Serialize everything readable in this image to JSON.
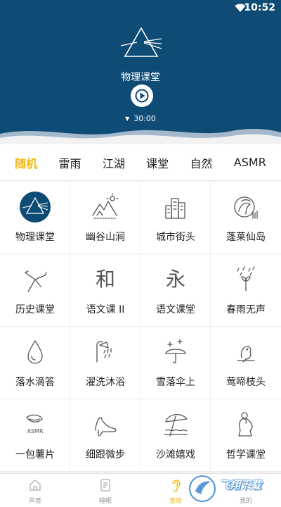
{
  "status_bar": {
    "time": "10:52",
    "wifi_icon": "wifi-icon"
  },
  "now_playing": {
    "title": "物理课堂",
    "timer": "30:00",
    "icon": "prism-icon"
  },
  "tabs": [
    {
      "label": "随机",
      "active": true
    },
    {
      "label": "雷雨",
      "active": false
    },
    {
      "label": "江湖",
      "active": false
    },
    {
      "label": "课堂",
      "active": false
    },
    {
      "label": "自然",
      "active": false
    },
    {
      "label": "ASMR",
      "active": false
    }
  ],
  "sounds": [
    {
      "label": "物理课堂",
      "icon": "prism-icon",
      "selected": true
    },
    {
      "label": "幽谷山涧",
      "icon": "valley-icon"
    },
    {
      "label": "城市街头",
      "icon": "city-icon"
    },
    {
      "label": "蓬莱仙岛",
      "icon": "island-icon"
    },
    {
      "label": "历史课堂",
      "icon": "history-icon"
    },
    {
      "label": "语文课 II",
      "icon": "chinese-he-icon",
      "glyph": "和"
    },
    {
      "label": "语文课堂",
      "icon": "chinese-yong-icon",
      "glyph": "永"
    },
    {
      "label": "春雨无声",
      "icon": "spring-rain-icon"
    },
    {
      "label": "落水滴答",
      "icon": "water-drop-icon"
    },
    {
      "label": "濯洗沐浴",
      "icon": "shower-icon"
    },
    {
      "label": "雪落伞上",
      "icon": "snow-umbrella-icon"
    },
    {
      "label": "莺啼枝头",
      "icon": "bird-icon"
    },
    {
      "label": "一包薯片",
      "icon": "chips-icon",
      "icon_text": "ASMR"
    },
    {
      "label": "细跟微步",
      "icon": "high-heel-icon"
    },
    {
      "label": "沙滩嬉戏",
      "icon": "beach-icon"
    },
    {
      "label": "哲学课堂",
      "icon": "thinker-icon"
    }
  ],
  "bottom_nav": [
    {
      "label": "声音",
      "icon": "home-icon",
      "active": false
    },
    {
      "label": "睡眠",
      "icon": "sleep-icon",
      "active": false
    },
    {
      "label": "音效",
      "icon": "ear-icon",
      "active": true
    },
    {
      "label": "我的",
      "icon": "user-icon",
      "active": false
    }
  ],
  "watermark": {
    "text": "飞翔下载"
  },
  "colors": {
    "header_bg": "#0f4c75",
    "accent": "#f2b80f"
  }
}
